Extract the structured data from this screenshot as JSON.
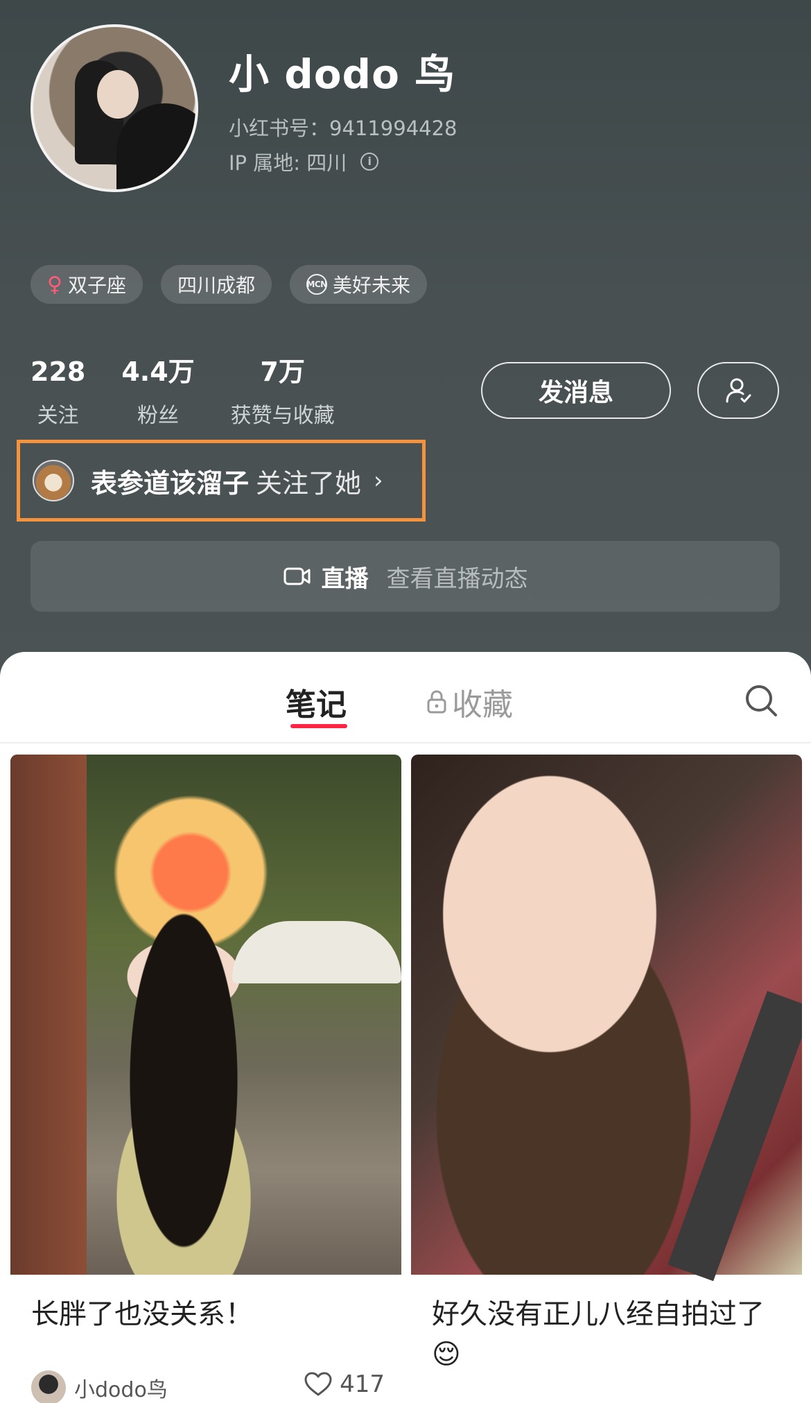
{
  "profile": {
    "nickname": "小 dodo 鸟",
    "red_id": "小红书号：9411994428",
    "ip_location": "IP 属地: 四川",
    "tags": [
      "双子座",
      "四川成都",
      "美好未来"
    ],
    "mcn_badge": "MCN"
  },
  "stats": {
    "following": {
      "value": "228",
      "label": "关注"
    },
    "followers": {
      "value": "4.4万",
      "label": "粉丝"
    },
    "likes": {
      "value": "7万",
      "label": "获赞与收藏"
    }
  },
  "actions": {
    "message_label": "发消息"
  },
  "followed_by": {
    "name": "表参道该溜子",
    "suffix": "关注了她",
    "chevron": "›"
  },
  "live": {
    "label": "直播",
    "sub": "查看直播动态"
  },
  "tabs": {
    "notes": "笔记",
    "collections": "收藏"
  },
  "notes": [
    {
      "title": "长胖了也没关系！",
      "author": "小dodo鸟",
      "likes": "417"
    },
    {
      "title": "好久没有正儿八经自拍过了😌"
    }
  ],
  "colors": {
    "accent": "#ff2442",
    "highlight_border": "#f5923e",
    "header_bg": "#485052"
  }
}
